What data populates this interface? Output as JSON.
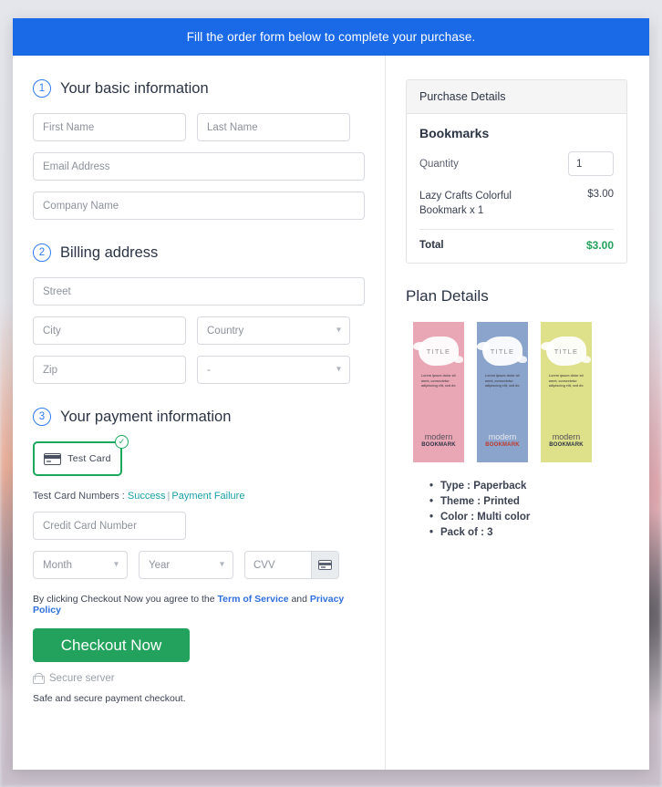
{
  "banner": {
    "text": "Fill the order form below to complete your purchase."
  },
  "colors": {
    "banner_blue": "#1a6ae8",
    "step_blue": "#2f7bf0",
    "green": "#22a25c",
    "tile_green": "#1aa85c",
    "teal_link": "#18a0a8",
    "link_blue": "#2f6fdd"
  },
  "sections": {
    "basic": {
      "number": "1",
      "title": "Your basic information",
      "fields": {
        "first_name": {
          "placeholder": "First Name",
          "value": ""
        },
        "last_name": {
          "placeholder": "Last Name",
          "value": ""
        },
        "email": {
          "placeholder": "Email Address",
          "value": ""
        },
        "company": {
          "placeholder": "Company Name",
          "value": ""
        }
      }
    },
    "billing": {
      "number": "2",
      "title": "Billing address",
      "fields": {
        "street": {
          "placeholder": "Street",
          "value": ""
        },
        "city": {
          "placeholder": "City",
          "value": ""
        },
        "country": {
          "selected": "Country"
        },
        "zip": {
          "placeholder": "Zip",
          "value": ""
        },
        "state": {
          "selected": "-"
        }
      }
    },
    "payment": {
      "number": "3",
      "title": "Your payment information",
      "method_tile": {
        "label": "Test  Card",
        "selected": true
      },
      "test_card_numbers": {
        "prefix": "Test Card Numbers : ",
        "success_link": "Success",
        "separator": "|",
        "failure_link": "Payment Failure"
      },
      "fields": {
        "credit_card_number": {
          "placeholder": "Credit Card Number",
          "value": ""
        },
        "month": {
          "selected": "Month"
        },
        "year": {
          "selected": "Year"
        },
        "cvv": {
          "placeholder": "CVV",
          "value": ""
        }
      },
      "terms": {
        "prefix": "By clicking Checkout Now you agree to the ",
        "tos_link": "Term of Service",
        "middle": " and ",
        "privacy_link": "Privacy Policy"
      },
      "checkout_button": "Checkout Now",
      "secure_server": "Secure server",
      "safe_note": "Safe and secure payment checkout."
    }
  },
  "purchase_details": {
    "header": "Purchase Details",
    "product_name": "Bookmarks",
    "quantity_label": "Quantity",
    "quantity_value": "1",
    "line_item": {
      "name": "Lazy Crafts Colorful Bookmark x 1",
      "price": "$3.00"
    },
    "total_label": "Total",
    "total_amount": "$3.00"
  },
  "plan_details": {
    "title": "Plan Details",
    "bookmarks": [
      {
        "color": "#e9a7b6",
        "title": "TITLE",
        "lorem": "Lorem ipsum dolor sit amet, consectetur adipiscing elit, sed do",
        "brand_top": "modern",
        "brand_bottom": "BOOKMARK"
      },
      {
        "color": "#8ba4cc",
        "title": "TITLE",
        "lorem": "Lorem ipsum dolor sit amet, consectetur adipiscing elit, sed do",
        "brand_top": "modern",
        "brand_bottom": "BOOKMARK"
      },
      {
        "color": "#dfe08a",
        "title": "TITLE",
        "lorem": "Lorem ipsum dolor sit amet, consectetur adipiscing elit, sed do",
        "brand_top": "modern",
        "brand_bottom": "BOOKMARK"
      }
    ],
    "features": [
      "Type : Paperback",
      "Theme : Printed",
      "Color : Multi color",
      "Pack of : 3"
    ]
  }
}
